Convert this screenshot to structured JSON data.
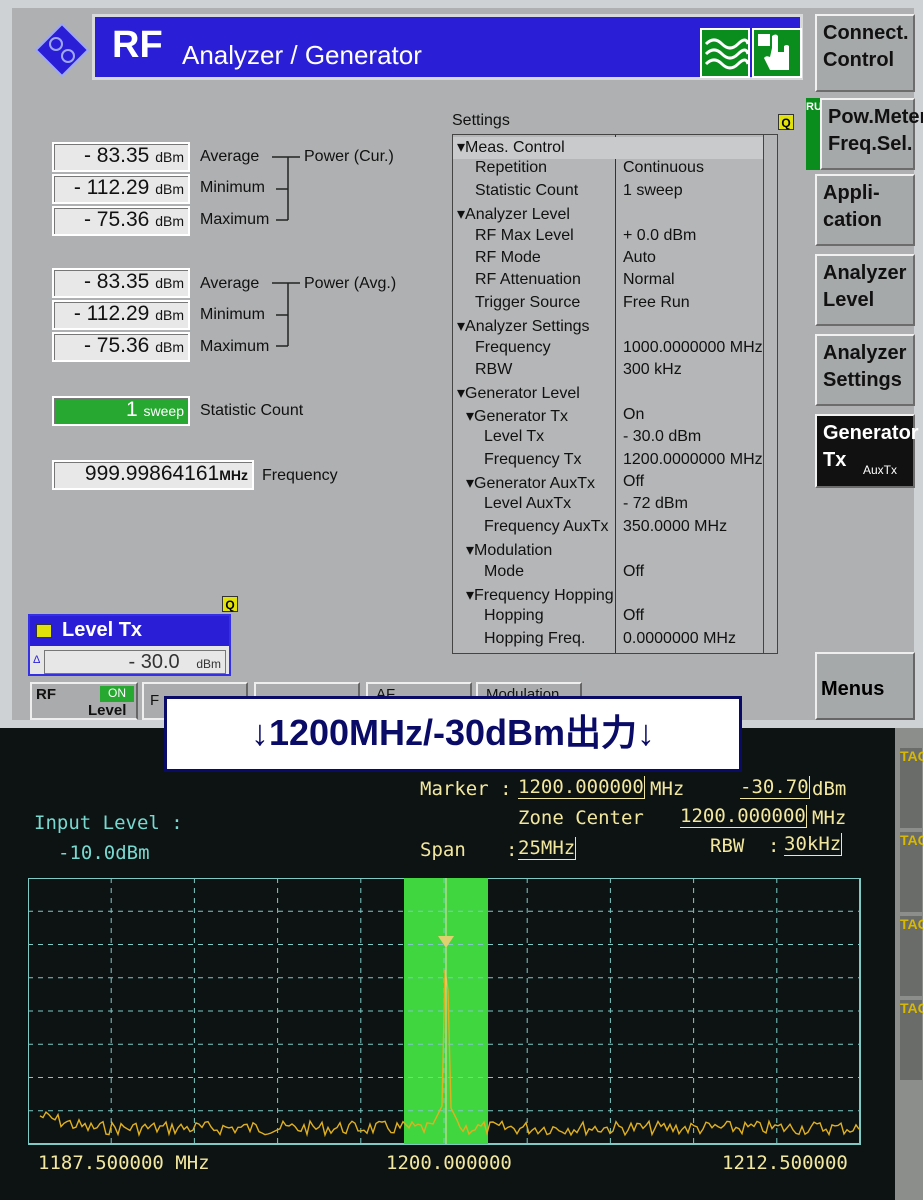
{
  "app": {
    "logo_letters": "R&S",
    "title_rf": "RF",
    "title_main": "Analyzer / Generator"
  },
  "side_buttons": [
    {
      "id": "connect-control",
      "label": "Connect. Control"
    },
    {
      "id": "pow-meter",
      "label": "Pow.Meter Freq.Sel.",
      "run": "RUN"
    },
    {
      "id": "application",
      "label": "Appli- cation"
    },
    {
      "id": "analyzer-level",
      "label": "Analyzer Level"
    },
    {
      "id": "analyzer-settings",
      "label": "Analyzer Settings"
    },
    {
      "id": "generator-tx",
      "label": "Generator Tx",
      "sub": "AuxTx"
    }
  ],
  "menus_label": "Menus",
  "power_cur": {
    "group_label": "Power (Cur.)",
    "rows": [
      {
        "value": "- 83.35",
        "unit": "dBm",
        "label": "Average"
      },
      {
        "value": "- 112.29",
        "unit": "dBm",
        "label": "Minimum"
      },
      {
        "value": "- 75.36",
        "unit": "dBm",
        "label": "Maximum"
      }
    ]
  },
  "power_avg": {
    "group_label": "Power (Avg.)",
    "rows": [
      {
        "value": "- 83.35",
        "unit": "dBm",
        "label": "Average"
      },
      {
        "value": "- 112.29",
        "unit": "dBm",
        "label": "Minimum"
      },
      {
        "value": "- 75.36",
        "unit": "dBm",
        "label": "Maximum"
      }
    ]
  },
  "statistic": {
    "value": "1",
    "unit": "sweep",
    "label": "Statistic Count"
  },
  "frequency": {
    "value": "999.99864161",
    "unit": "MHz",
    "label": "Frequency"
  },
  "settings": {
    "title": "Settings",
    "rows": [
      {
        "key": "▾Meas. Control",
        "value": "",
        "indent": 0
      },
      {
        "key": "Repetition",
        "value": "Continuous",
        "indent": 2
      },
      {
        "key": "Statistic Count",
        "value": "1  sweep",
        "indent": 2
      },
      {
        "key": "▾Analyzer Level",
        "value": "",
        "indent": 0
      },
      {
        "key": "RF Max Level",
        "value": "+ 0.0  dBm",
        "indent": 2
      },
      {
        "key": "RF Mode",
        "value": "Auto",
        "indent": 2
      },
      {
        "key": "RF Attenuation",
        "value": "Normal",
        "indent": 2
      },
      {
        "key": "Trigger Source",
        "value": "Free Run",
        "indent": 2
      },
      {
        "key": "▾Analyzer Settings",
        "value": "",
        "indent": 0
      },
      {
        "key": "Frequency",
        "value": "1000.0000000 MHz",
        "indent": 2
      },
      {
        "key": "RBW",
        "value": "300 kHz",
        "indent": 2
      },
      {
        "key": "▾Generator Level",
        "value": "",
        "indent": 0
      },
      {
        "key": "▾Generator Tx",
        "value": "On",
        "indent": 1
      },
      {
        "key": "Level Tx",
        "value": "- 30.0  dBm",
        "indent": 3
      },
      {
        "key": "Frequency Tx",
        "value": "1200.0000000 MHz",
        "indent": 3
      },
      {
        "key": "▾Generator AuxTx",
        "value": "Off",
        "indent": 1
      },
      {
        "key": "Level AuxTx",
        "value": "- 72  dBm",
        "indent": 3
      },
      {
        "key": "Frequency AuxTx",
        "value": "350.0000  MHz",
        "indent": 3
      },
      {
        "key": "▾Modulation",
        "value": "",
        "indent": 1
      },
      {
        "key": "Mode",
        "value": "Off",
        "indent": 3
      },
      {
        "key": "▾Frequency Hopping",
        "value": "",
        "indent": 1
      },
      {
        "key": "Hopping",
        "value": "Off",
        "indent": 3
      },
      {
        "key": "Hopping Freq.",
        "value": "0.0000000 MHz",
        "indent": 3
      }
    ]
  },
  "level_tx": {
    "title": "Level Tx",
    "delta": "Δ",
    "value": "- 30.0",
    "unit": "dBm"
  },
  "bottom_tabs": [
    {
      "label": "RF",
      "badge_on": "ON",
      "badge_sub": "Level"
    },
    {
      "label": "F"
    },
    {
      "label": ""
    },
    {
      "label": "AF"
    },
    {
      "label": "Modulation"
    }
  ],
  "caption": "↓1200MHz/-30dBm出力↓",
  "spectrum": {
    "input_level_label": "Input Level :",
    "input_level_value": "-10.0dBm",
    "marker_label": "Marker :",
    "marker_freq": "1200.000000",
    "marker_freq_unit": "MHz",
    "marker_level": "-30.70",
    "marker_level_unit": "dBm",
    "zone_center_label": "Zone Center",
    "zone_center_value": "1200.000000",
    "zone_center_unit": "MHz",
    "span_label": "Span",
    "span_sep": ":",
    "span_value": "25MHz",
    "rbw_label": "RBW",
    "rbw_sep": ":",
    "rbw_value": "30kHz",
    "freq_start": "1187.500000  MHz",
    "freq_center": "1200.000000",
    "freq_stop": "1212.500000",
    "tag_label": "TAG",
    "colors": {
      "trace": "#e0b020",
      "zone": "#3fd63f",
      "grid": "#7fcac4"
    }
  }
}
